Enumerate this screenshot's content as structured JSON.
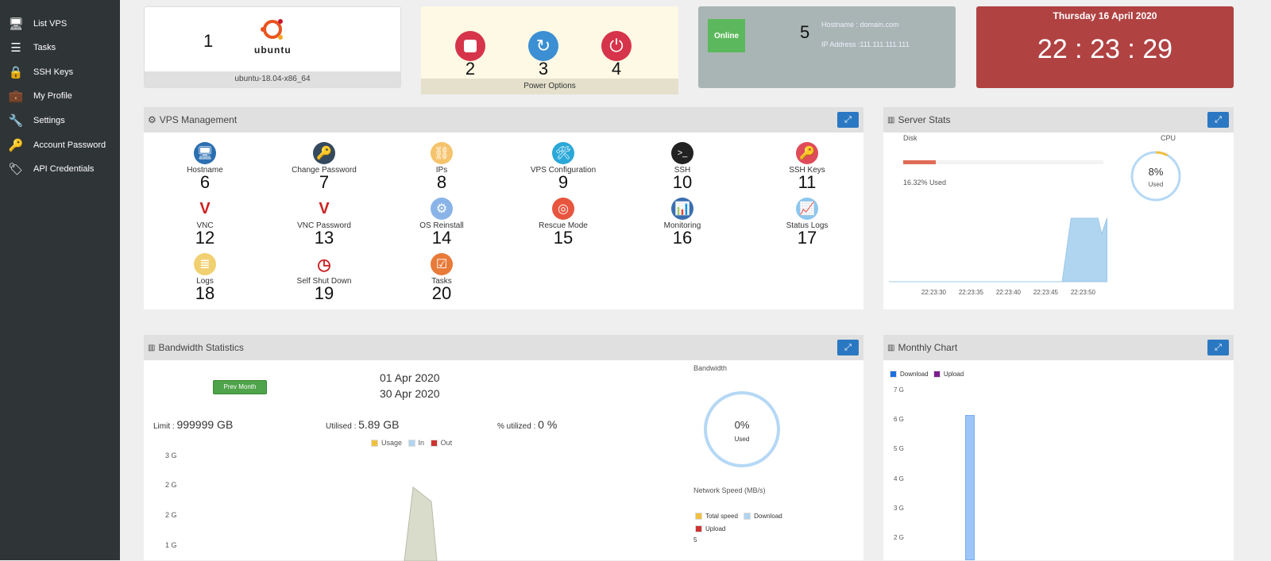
{
  "sidebar": {
    "items": [
      {
        "label": "List VPS",
        "icon": "monitor-icon"
      },
      {
        "label": "Tasks",
        "icon": "tasks-icon"
      },
      {
        "label": "SSH Keys",
        "icon": "lock-icon"
      },
      {
        "label": "My Profile",
        "icon": "briefcase-icon"
      },
      {
        "label": "Settings",
        "icon": "wrench-icon"
      },
      {
        "label": "Account Password",
        "icon": "key-icon"
      },
      {
        "label": "API Credentials",
        "icon": "tags-icon"
      }
    ]
  },
  "os_card": {
    "number": "1",
    "logo_text": "ubuntu",
    "os_name": "ubuntu-18.04-x86_64"
  },
  "power_card": {
    "label": "Power Options",
    "buttons": [
      {
        "number": "2",
        "name": "stop"
      },
      {
        "number": "3",
        "name": "restart"
      },
      {
        "number": "4",
        "name": "power"
      }
    ]
  },
  "status_card": {
    "status": "Online",
    "number": "5",
    "hostname": "Hostname : domain.com",
    "ip": "IP Address :111.111.111.111",
    "status_color": "#5cb85c"
  },
  "clock_card": {
    "date": "Thursday 16 April 2020",
    "time": "22 : 23 : 29"
  },
  "vps_management": {
    "title": "VPS Management",
    "tools": [
      {
        "label": "Hostname",
        "number": "6"
      },
      {
        "label": "Change Password",
        "number": "7"
      },
      {
        "label": "IPs",
        "number": "8"
      },
      {
        "label": "VPS Configuration",
        "number": "9"
      },
      {
        "label": "SSH",
        "number": "10"
      },
      {
        "label": "SSH Keys",
        "number": "11"
      },
      {
        "label": "VNC",
        "number": "12"
      },
      {
        "label": "VNC Password",
        "number": "13"
      },
      {
        "label": "OS Reinstall",
        "number": "14"
      },
      {
        "label": "Rescue Mode",
        "number": "15"
      },
      {
        "label": "Monitoring",
        "number": "16"
      },
      {
        "label": "Status Logs",
        "number": "17"
      },
      {
        "label": "Logs",
        "number": "18"
      },
      {
        "label": "Self Shut Down",
        "number": "19"
      },
      {
        "label": "Tasks",
        "number": "20"
      }
    ]
  },
  "server_stats": {
    "title": "Server Stats",
    "disk_label": "Disk",
    "disk_used_pct": 16.32,
    "disk_used_text": "16.32% Used",
    "cpu_label": "CPU",
    "cpu_pct": 8,
    "cpu_text": "8%",
    "cpu_used": "Used",
    "chart": {
      "x_labels": [
        "22:23:30",
        "22:23:35",
        "22:23:40",
        "22:23:45",
        "22:23:50"
      ],
      "points": [
        [
          24,
          0
        ],
        [
          47.2,
          0
        ],
        [
          48.4,
          10
        ],
        [
          52,
          10
        ],
        [
          52.5,
          7.5
        ],
        [
          53.2,
          10
        ]
      ]
    }
  },
  "bandwidth": {
    "title": "Bandwidth Statistics",
    "prev_month": "Prev Month",
    "start_date": "01 Apr 2020",
    "end_date": "30 Apr 2020",
    "limit_label": "Limit :",
    "limit_value": "999999 GB",
    "utilised_label": "Utilised :",
    "utilised_value": "5.89 GB",
    "pct_label": "% utilized :",
    "pct_value": "0 %",
    "legend": [
      {
        "label": "Usage",
        "color": "#f0c040"
      },
      {
        "label": "In",
        "color": "#b0d4f0"
      },
      {
        "label": "Out",
        "color": "#cc3333"
      }
    ],
    "y_ticks": [
      "3 G",
      "2 G",
      "2 G",
      "1 G"
    ],
    "gauge_title": "Bandwidth",
    "gauge_text": "0%",
    "gauge_used": "Used",
    "speed_title": "Network Speed (MB/s)",
    "speed_legend": [
      {
        "label": "Total speed",
        "color": "#f0c040"
      },
      {
        "label": "Download",
        "color": "#b0d4f0"
      },
      {
        "label": "Upload",
        "color": "#cc3333"
      }
    ],
    "speed_tick": "5"
  },
  "monthly": {
    "title": "Monthly Chart",
    "legend": [
      {
        "label": "Download",
        "color": "#1e6fe0"
      },
      {
        "label": "Upload",
        "color": "#7d1e8f"
      }
    ],
    "y_ticks": [
      "7 G",
      "6 G",
      "5 G",
      "4 G",
      "3 G",
      "2 G"
    ],
    "bars": [
      {
        "download": 6.2,
        "upload": 0
      }
    ]
  }
}
